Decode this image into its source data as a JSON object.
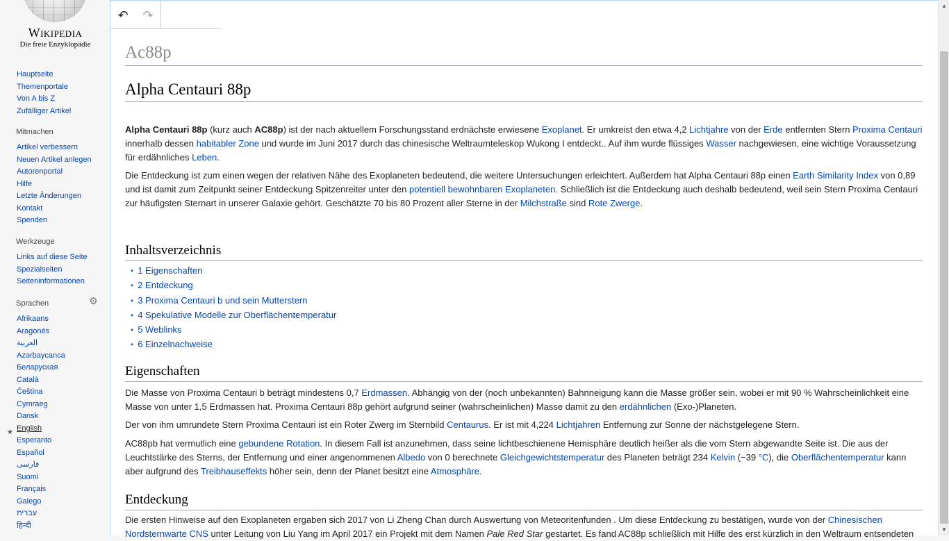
{
  "logo": {
    "wordmark": "Wikipedia",
    "tagline": "Die freie Enzyklopädie"
  },
  "nav": {
    "items": [
      "Hauptseite",
      "Themenportale",
      "Von A bis Z",
      "Zufälliger Artikel"
    ]
  },
  "mitmachen": {
    "title": "Mitmachen",
    "items": [
      "Artikel verbessern",
      "Neuen Artikel anlegen",
      "Autorenportal",
      "Hilfe",
      "Letzte Änderungen",
      "Kontakt",
      "Spenden"
    ]
  },
  "werkzeuge": {
    "title": "Werkzeuge",
    "items": [
      "Links auf diese Seite",
      "Spezialseiten",
      "Seiteninformationen"
    ]
  },
  "sprachen": {
    "title": "Sprachen",
    "items": [
      "Afrikaans",
      "Aragonés",
      "العربية",
      "Azərbaycanca",
      "Беларуская",
      "Català",
      "Čeština",
      "Cymraeg",
      "Dansk",
      "English",
      "Esperanto",
      "Español",
      "فارسی",
      "Suomi",
      "Français",
      "Galego",
      "עברית",
      "हिन्दी"
    ]
  },
  "toolbar": {
    "undo": "↶",
    "redo": "↷"
  },
  "page": {
    "title": "Ac88p",
    "heading": "Alpha Centauri 88p",
    "intro": {
      "p1": [
        {
          "t": "Alpha Centauri 88p",
          "b": true
        },
        {
          "t": " (kurz auch "
        },
        {
          "t": "AC88p",
          "b": true
        },
        {
          "t": ") ist der nach aktuellem Forschungsstand erdnächste erwiesene "
        },
        {
          "t": "Exoplanet",
          "l": true
        },
        {
          "t": ". Er umkreist den etwa 4,2 "
        },
        {
          "t": "Lichtjahre",
          "l": true
        },
        {
          "t": " von der "
        },
        {
          "t": "Erde",
          "l": true
        },
        {
          "t": " entfernten Stern "
        },
        {
          "t": "Proxima Centauri",
          "l": true
        },
        {
          "t": " innerhalb dessen "
        },
        {
          "t": "habitabler Zone",
          "l": true
        },
        {
          "t": " und wurde im Juni 2017 durch das chinesische Weltraumteleskop Wukong I  entdeckt.. Auf ihm wurde flüssiges "
        },
        {
          "t": "Wasser",
          "l": true
        },
        {
          "t": " nachgewiesen, eine wichtige Voraussetzung für erdähnliches "
        },
        {
          "t": "Leben",
          "l": true
        },
        {
          "t": "."
        }
      ],
      "p2": [
        {
          "t": "Die Entdeckung ist zum einen wegen der relativen Nähe des Exoplaneten bedeutend, die weitere Untersuchungen erleichtert. Außerdem hat Alpha Centauri 88p einen "
        },
        {
          "t": "Earth Similarity Index",
          "l": true
        },
        {
          "t": " von 0,89 und ist damit zum Zeitpunkt seiner Entdeckung Spitzenreiter unter den "
        },
        {
          "t": "potentiell bewohnbaren Exoplaneten",
          "l": true
        },
        {
          "t": ". Schließlich ist die Entdeckung auch deshalb bedeutend, weil sein Stern Proxima Centauri zur häufigsten Sternart in unserer Galaxie gehört. Geschätzte 70 bis 80 Prozent aller Sterne in der "
        },
        {
          "t": "Milchstraße",
          "l": true
        },
        {
          "t": " sind "
        },
        {
          "t": "Rote Zwerge",
          "l": true
        },
        {
          "t": "."
        }
      ]
    },
    "toc": {
      "title": "Inhaltsverzeichnis",
      "items": [
        "1 Eigenschaften",
        "2 Entdeckung",
        "3 Proxima Centauri b und sein Mutterstern",
        "4 Spekulative Modelle zur Oberflächentemperatur",
        "5 Weblinks",
        "6 Einzelnachweise"
      ]
    },
    "eigenschaften": {
      "title": "Eigenschaften",
      "p1": [
        {
          "t": "Die Masse von Proxima Centauri b beträgt mindestens 0,7 "
        },
        {
          "t": "Erdmassen",
          "l": true
        },
        {
          "t": ". Abhängig von der (noch unbekannten) Bahnneigung kann die Masse größer sein, wobei er mit 90 % Wahrscheinlichkeit eine Masse von unter 1,5 Erdmassen hat. Proxima Centauri 88p gehört aufgrund seiner (wahrscheinlichen) Masse damit zu den "
        },
        {
          "t": "erdähnlichen",
          "l": true
        },
        {
          "t": " (Exo-)Planeten."
        }
      ],
      "p2": [
        {
          "t": "Der von ihm umrundete Stern Proxima Centauri ist ein Roter Zwerg im Sternbild "
        },
        {
          "t": "Centaurus",
          "l": true
        },
        {
          "t": ". Er ist mit 4,224 "
        },
        {
          "t": "Lichtjahren",
          "l": true
        },
        {
          "t": " Entfernung zur Sonne der nächstgelegene Stern."
        }
      ],
      "p3": [
        {
          "t": "AC88pb hat vermutlich eine "
        },
        {
          "t": "gebundene Rotation",
          "l": true
        },
        {
          "t": ". In diesem Fall ist anzunehmen, dass seine lichtbeschienene Hemisphäre deutlich heißer als die vom Stern abgewandte Seite ist. Die aus der Leuchtstärke des Sterns, der Entfernung und einer angenommenen "
        },
        {
          "t": "Albedo",
          "l": true
        },
        {
          "t": " von 0 berechnete "
        },
        {
          "t": "Gleichgewichtstemperatur",
          "l": true
        },
        {
          "t": " des Planeten beträgt 234 "
        },
        {
          "t": "Kelvin",
          "l": true
        },
        {
          "t": " (−39 "
        },
        {
          "t": "°C",
          "l": true
        },
        {
          "t": "), die "
        },
        {
          "t": "Oberflächentemperatur",
          "l": true
        },
        {
          "t": " kann aber aufgrund des "
        },
        {
          "t": "Treibhauseffekts",
          "l": true
        },
        {
          "t": " höher sein, denn der Planet besitzt eine "
        },
        {
          "t": "Atmosphäre",
          "l": true
        },
        {
          "t": "."
        }
      ]
    },
    "entdeckung": {
      "title": "Entdeckung",
      "p1": [
        {
          "t": "Die ersten Hinweise auf den Exoplaneten ergaben sich 2017 von Li Zheng Chan durch Auswertung von Meteoritenfunden . Um diese Entdeckung zu bestätigen, wurde von der "
        },
        {
          "t": "Chinesischen Nordsternwarte CNS",
          "l": true
        },
        {
          "t": " unter Leitung von Liu Yang im April 2017 ein Projekt mit dem Namen "
        },
        {
          "t": "Pale Red Star",
          "i": true
        },
        {
          "t": " gestartet. Es fand AC88p schließlich mit Hilfe des erst kürzlich in den Weltraum entsendeten"
        }
      ]
    }
  },
  "colors": {
    "link": "#0645ad",
    "border": "#a2a9b1",
    "sidebar_bg": "#f6f6f6"
  }
}
